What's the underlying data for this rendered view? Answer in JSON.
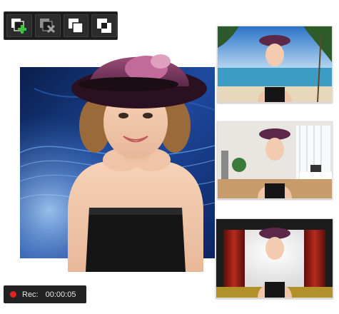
{
  "toolbar": {
    "buttons": [
      {
        "name": "add-layer-button",
        "icon": "add-layer-icon"
      },
      {
        "name": "remove-layer-button",
        "icon": "remove-layer-icon"
      },
      {
        "name": "bring-to-front-button",
        "icon": "bring-to-front-icon"
      },
      {
        "name": "send-to-back-button",
        "icon": "send-to-back-icon"
      }
    ]
  },
  "backgrounds": [
    {
      "name": "beach-background-thumbnail"
    },
    {
      "name": "office-background-thumbnail"
    },
    {
      "name": "stage-curtain-background-thumbnail"
    }
  ],
  "preview": {
    "background_name": "blue-waves-background"
  },
  "recording": {
    "label": "Rec:",
    "time": "00:00:05",
    "indicator_color": "#e52222"
  }
}
